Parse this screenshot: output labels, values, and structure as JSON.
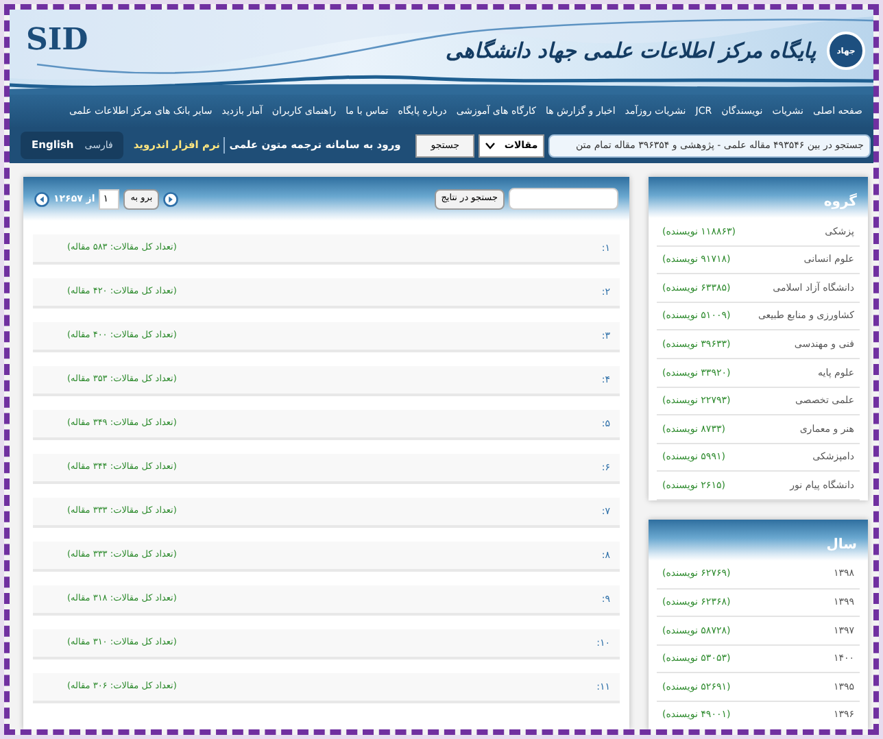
{
  "header": {
    "logo": "SID",
    "title": "پایگاه مرکز اطلاعات علمی جهاد دانشگاهی",
    "emblem": "جهاد"
  },
  "nav": [
    "صفحه اصلی",
    "نشریات",
    "نویسندگان",
    "JCR",
    "نشریات روزآمد",
    "اخبار و گزارش ها",
    "کارگاه های آموزشی",
    "درباره پایگاه",
    "تماس با ما",
    "راهنمای کاربران",
    "آمار بازدید",
    "سایر بانک های مرکز اطلاعات علمی"
  ],
  "search": {
    "placeholder": "جستجو در بین ۴۹۳۵۴۶ مقاله علمی - پژوهشی و ۳۹۶۳۵۴ مقاله تمام متن",
    "select": "مقالات",
    "button": "جستجو",
    "translation_link": "ورود به سامانه ترجمه متون علمی",
    "android_link": "نرم افزار اندروید",
    "languages": [
      {
        "label": "فارسی",
        "selected": true
      },
      {
        "label": "English",
        "selected": false
      }
    ]
  },
  "results": {
    "search_button": "جستجو در نتایج",
    "goto_button": "برو به",
    "page": "۱",
    "total": "از ۱۲۶۵۷",
    "rows": [
      {
        "number": "۱:",
        "count": "(تعداد کل مقالات: ۵۸۳ مقاله)"
      },
      {
        "number": "۲:",
        "count": "(تعداد کل مقالات: ۴۲۰ مقاله)"
      },
      {
        "number": "۳:",
        "count": "(تعداد کل مقالات: ۴۰۰ مقاله)"
      },
      {
        "number": "۴:",
        "count": "(تعداد کل مقالات: ۳۵۳ مقاله)"
      },
      {
        "number": "۵:",
        "count": "(تعداد کل مقالات: ۳۴۹ مقاله)"
      },
      {
        "number": "۶:",
        "count": "(تعداد کل مقالات: ۳۴۴ مقاله)"
      },
      {
        "number": "۷:",
        "count": "(تعداد کل مقالات: ۳۳۳ مقاله)"
      },
      {
        "number": "۸:",
        "count": "(تعداد کل مقالات: ۳۳۳ مقاله)"
      },
      {
        "number": "۹:",
        "count": "(تعداد کل مقالات: ۳۱۸ مقاله)"
      },
      {
        "number": "۱۰:",
        "count": "(تعداد کل مقالات: ۳۱۰ مقاله)"
      },
      {
        "number": "۱۱:",
        "count": "(تعداد کل مقالات: ۳۰۶ مقاله)"
      }
    ]
  },
  "groups": {
    "title": "گروه",
    "items": [
      {
        "name": "پزشکی",
        "count": "(۱۱۸۸۶۳ نویسنده)"
      },
      {
        "name": "علوم انسانی",
        "count": "(۹۱۷۱۸ نویسنده)"
      },
      {
        "name": "دانشگاه آزاد اسلامی",
        "count": "(۶۳۳۸۵ نویسنده)"
      },
      {
        "name": "کشاورزی و منابع طبیعی",
        "count": "(۵۱۰۰۹ نویسنده)"
      },
      {
        "name": "فنی و مهندسی",
        "count": "(۳۹۶۳۳ نویسنده)"
      },
      {
        "name": "علوم پایه",
        "count": "(۳۳۹۲۰ نویسنده)"
      },
      {
        "name": "علمی تخصصی",
        "count": "(۲۲۷۹۳ نویسنده)"
      },
      {
        "name": "هنر و معماری",
        "count": "(۸۷۳۳ نویسنده)"
      },
      {
        "name": "دامپزشکی",
        "count": "(۵۹۹۱ نویسنده)"
      },
      {
        "name": "دانشگاه پیام نور",
        "count": "(۲۶۱۵ نویسنده)"
      }
    ]
  },
  "years": {
    "title": "سال",
    "items": [
      {
        "name": "۱۳۹۸",
        "count": "(۶۲۷۶۹ نویسنده)"
      },
      {
        "name": "۱۳۹۹",
        "count": "(۶۲۳۶۸ نویسنده)"
      },
      {
        "name": "۱۳۹۷",
        "count": "(۵۸۷۲۸ نویسنده)"
      },
      {
        "name": "۱۴۰۰",
        "count": "(۵۳۰۵۳ نویسنده)"
      },
      {
        "name": "۱۳۹۵",
        "count": "(۵۲۶۹۱ نویسنده)"
      },
      {
        "name": "۱۳۹۶",
        "count": "(۴۹۰۰۱ نویسنده)"
      }
    ]
  }
}
